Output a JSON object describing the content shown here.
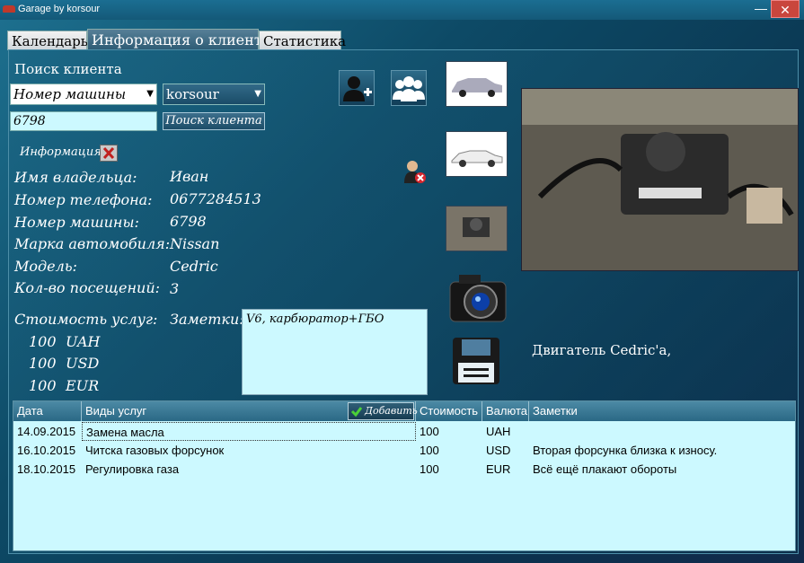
{
  "window": {
    "title": "Garage by korsour",
    "minimize": "—",
    "close": "✕"
  },
  "tabs": [
    {
      "label": "Календарь"
    },
    {
      "label": "Информация о клиенте"
    },
    {
      "label": "Статистика"
    }
  ],
  "search": {
    "title": "Поиск клиента",
    "field_select": "Номер машины",
    "user_select": "korsour",
    "query": "6798",
    "button": "Поиск клиента"
  },
  "info": {
    "title": "Информация",
    "owner_label": "Имя владельца:",
    "owner_value": "Иван",
    "phone_label": "Номер телефона:",
    "phone_value": "0677284513",
    "plate_label": "Номер машины:",
    "plate_value": "6798",
    "brand_label": "Марка автомобиля:",
    "brand_value": "Nissan",
    "model_label": "Модель:",
    "model_value": "Cedric",
    "visits_label": "Кол-во посещений:",
    "visits_value": "3",
    "cost_label": "Стоимость услуг:",
    "notes_label": "Заметки:",
    "notes_value": "V6, карбюратор+ГБО",
    "costs": [
      {
        "amount": "100",
        "currency": "UAH"
      },
      {
        "amount": "100",
        "currency": "USD"
      },
      {
        "amount": "100",
        "currency": "EUR"
      }
    ]
  },
  "photo": {
    "caption": "Двигатель Cedric'а,"
  },
  "grid": {
    "columns": [
      "Дата",
      "Виды услуг",
      "Стоимость",
      "Валюта",
      "Заметки"
    ],
    "add_button": "Добавить",
    "rows": [
      [
        "14.09.2015",
        "Замена масла",
        "100",
        "UAH",
        ""
      ],
      [
        "16.10.2015",
        "Читска газовых форсунок",
        "100",
        "USD",
        "Вторая форсунка близка к износу."
      ],
      [
        "18.10.2015",
        "Регулировка газа",
        "100",
        "EUR",
        "Всё ещё плакают обороты"
      ]
    ]
  },
  "colors": {
    "background": "#0a3d55",
    "grid": "#ccf9ff",
    "accent": "#2a6885"
  }
}
